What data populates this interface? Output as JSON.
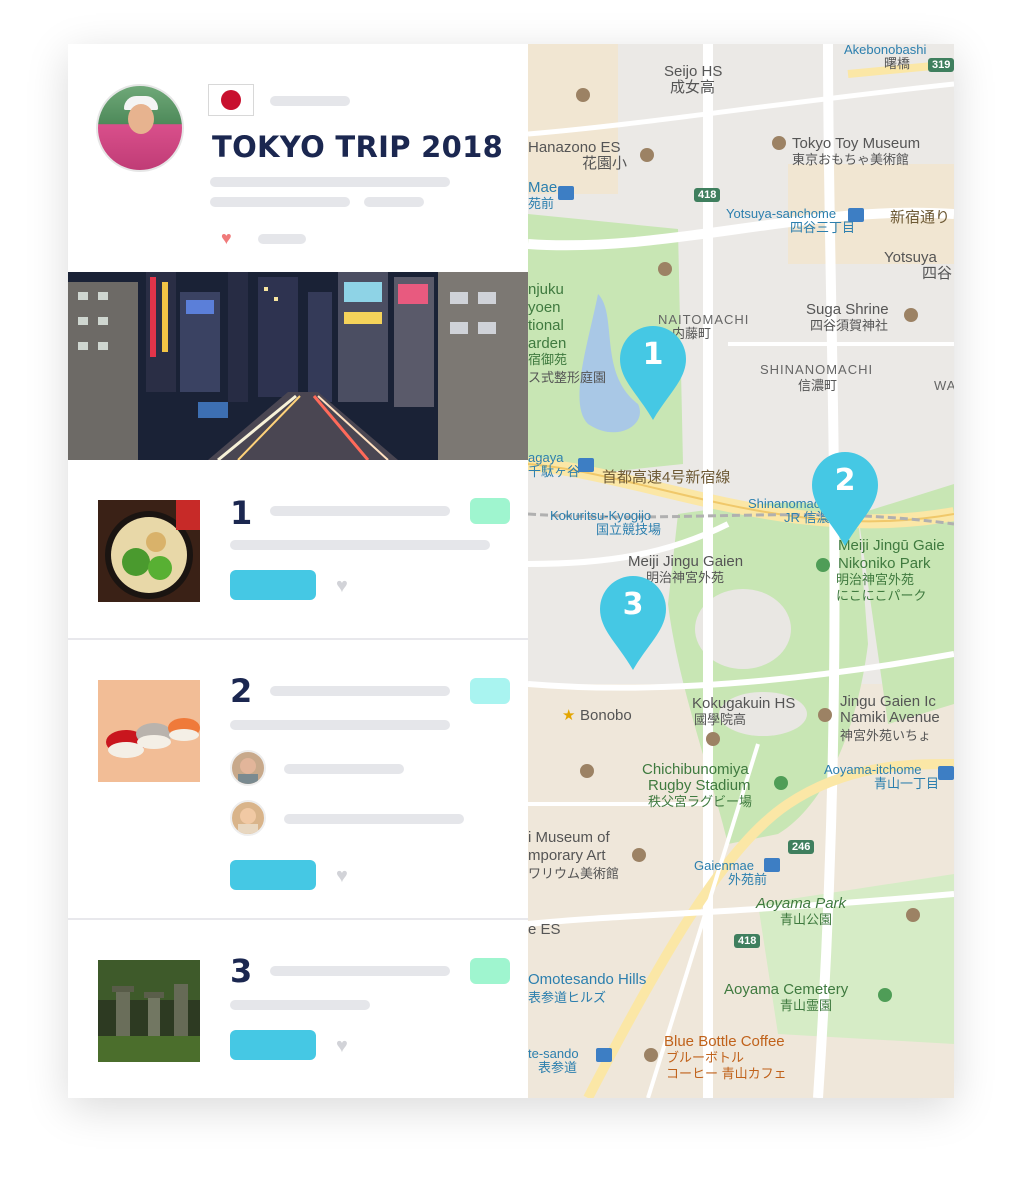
{
  "trip": {
    "title": "TOKYO TRIP 2018",
    "flag_icon": "japan-flag-icon"
  },
  "items": [
    {
      "number": "1"
    },
    {
      "number": "2"
    },
    {
      "number": "3"
    }
  ],
  "map": {
    "pins": [
      {
        "label": "1"
      },
      {
        "label": "2"
      },
      {
        "label": "3"
      }
    ],
    "route_shields": [
      "418",
      "418",
      "246",
      "319"
    ],
    "labels": {
      "seijo": "Seijo HS",
      "seijo_jp": "成女高",
      "akebonobashi": "Akebonobashi",
      "akebonobashi_jp": "曙橋",
      "hanazono": "Hanazono ES",
      "hanazono_jp": "花園小",
      "toy_museum": "Tokyo Toy Museum",
      "toy_museum_jp": "東京おもちゃ美術館",
      "mae": "Mae",
      "mae_jp": "苑前",
      "yotsuya_sanchome": "Yotsuya-sanchome",
      "yotsuya_sanchome_jp": "四谷三丁目",
      "shinjuku_dori": "新宿通り",
      "yotsuya": "Yotsuya",
      "yotsuya_jp": "四谷",
      "suga": "Suga Shrine",
      "suga_jp": "四谷須賀神社",
      "gyoen1": "njuku",
      "gyoen2": "yoen",
      "gyoen3": "tional",
      "gyoen4": "arden",
      "gyoen5": "宿御苑",
      "gyoen6": "ス式整形庭園",
      "naitomachi": "NAITOMACHI",
      "naitomachi_jp": "内藤町",
      "shinanomachi": "SHINANOMACHI",
      "shinanomachi_jp": "信濃町",
      "wa": "WA",
      "sendagaya": "agaya",
      "sendagaya_jp": "千駄ヶ谷",
      "expressway": "首都高速4号新宿線",
      "shinanomachi_st": "Shinanomachi",
      "shinanomachi_st_jp": "JR 信濃",
      "kokuritsu": "Kokuritsu-Kyogijo",
      "kokuritsu_jp": "国立競技場",
      "meiji_jingu": "Meiji Jingu Gaien",
      "meiji_jingu_jp": "明治神宮外苑",
      "nikoniko1": "Meiji Jingū Gaie",
      "nikoniko2": "Nikoniko Park",
      "nikoniko3": "明治神宮外苑",
      "nikoniko4": "にこにこパーク",
      "bonobo": "Bonobo",
      "kokugakuin": "Kokugakuin HS",
      "kokugakuin_jp": "國學院高",
      "jingu_gaien": "Jingu Gaien Ic",
      "namiki": "Namiki Avenue",
      "namiki_jp": "神宮外苑いちょ",
      "chichibu1": "Chichibunomiya",
      "chichibu2": "Rugby Stadium",
      "chichibu_jp": "秩父宮ラグビー場",
      "aoyama_itchome": "Aoyama-itchome",
      "aoyama_itchome_jp": "青山一丁目",
      "museum1": "i Museum of",
      "museum2": "mporary Art",
      "museum_jp": "ワリウム美術館",
      "gaienmae": "Gaienmae",
      "gaienmae_jp": "外苑前",
      "aoyama_park": "Aoyama Park",
      "aoyama_park_jp": "青山公園",
      "es": "e ES",
      "omotesando_hills": "Omotesando Hills",
      "omotesando_hills_jp": "表参道ヒルズ",
      "aoyama_cemetery": "Aoyama Cemetery",
      "aoyama_cemetery_jp": "青山霊園",
      "omotesando": "te-sando",
      "omotesando_jp": "表参道",
      "blue_bottle": "Blue Bottle Coffee",
      "blue_bottle_jp1": "ブルーボトル",
      "blue_bottle_jp2": "コーヒー 青山カフェ"
    }
  },
  "colors": {
    "pin": "#45c8e4",
    "title": "#1b2750",
    "accent_green": "#9ff5cf",
    "park": "#c8e6b4"
  }
}
